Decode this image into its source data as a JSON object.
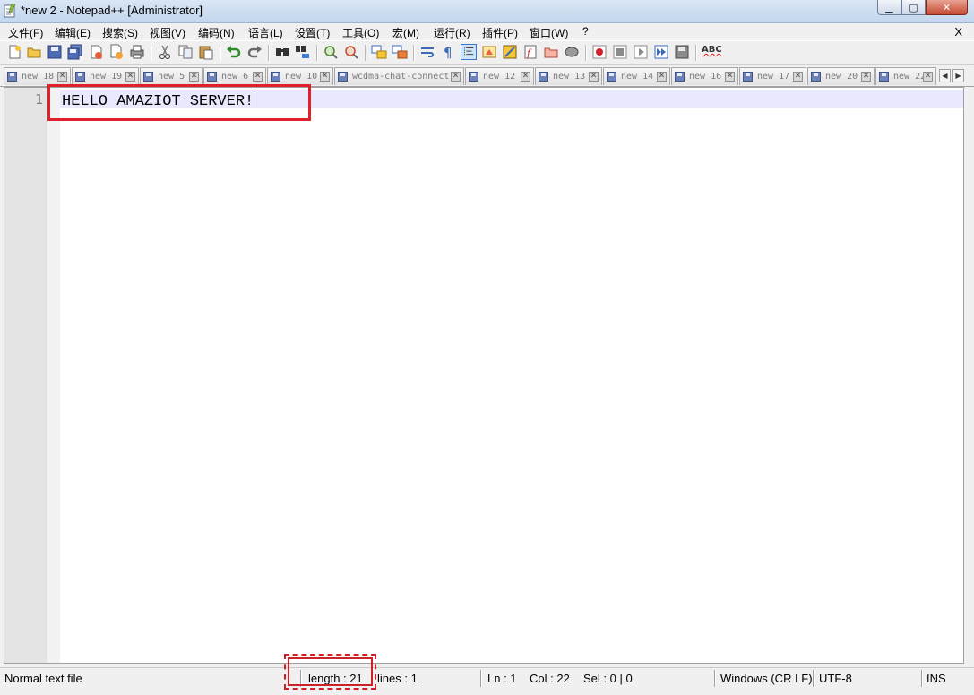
{
  "window": {
    "title": "*new 2 - Notepad++ [Administrator]",
    "min_symbol": "▁",
    "max_symbol": "▢",
    "close_symbol": "✕"
  },
  "menu": {
    "items": [
      "文件(F)",
      "编辑(E)",
      "搜索(S)",
      "视图(V)",
      "编码(N)",
      "语言(L)",
      "设置(T)",
      "工具(O)",
      "宏(M)",
      "运行(R)",
      "插件(P)",
      "窗口(W)",
      "?"
    ],
    "close_doc": "X"
  },
  "toolbar": {
    "spell_check_label": "ABC",
    "icons": [
      "new-file-icon",
      "open-file-icon",
      "save-icon",
      "save-all-icon",
      "close-icon",
      "close-all-icon",
      "print-icon",
      "cut-icon",
      "copy-icon",
      "paste-icon",
      "undo-icon",
      "redo-icon",
      "find-icon",
      "replace-icon",
      "zoom-in-icon",
      "zoom-out-icon",
      "sync-vertical-icon",
      "sync-horizontal-icon",
      "word-wrap-icon",
      "show-all-chars-icon",
      "indent-guide-icon",
      "user-define-icon",
      "doc-map-icon",
      "function-list-icon",
      "folder-workspace-icon",
      "monitor-icon",
      "record-macro-icon",
      "stop-record-icon",
      "play-macro-icon",
      "run-macro-multiple-icon",
      "save-macro-icon",
      "spell-check-icon"
    ]
  },
  "tabs": [
    {
      "label": "new 18"
    },
    {
      "label": "new 19"
    },
    {
      "label": "new 5"
    },
    {
      "label": "new 6"
    },
    {
      "label": "new 10"
    },
    {
      "label": "wcdma-chat-connect"
    },
    {
      "label": "new 12"
    },
    {
      "label": "new 13"
    },
    {
      "label": "new 14"
    },
    {
      "label": "new 16"
    },
    {
      "label": "new 17"
    },
    {
      "label": "new 20"
    },
    {
      "label": "new 22"
    }
  ],
  "editor": {
    "line_number": "1",
    "content": "HELLO AMAZIOT SERVER!"
  },
  "status": {
    "file_type": "Normal text file",
    "length": "length : 21",
    "lines": "lines : 1",
    "ln": "Ln : 1",
    "col": "Col : 22",
    "sel": "Sel : 0 | 0",
    "eol": "Windows (CR LF)",
    "encoding": "UTF-8",
    "mode": "INS"
  },
  "colors": {
    "highlight": "#e0212c",
    "current_line": "#e8e8ff"
  }
}
